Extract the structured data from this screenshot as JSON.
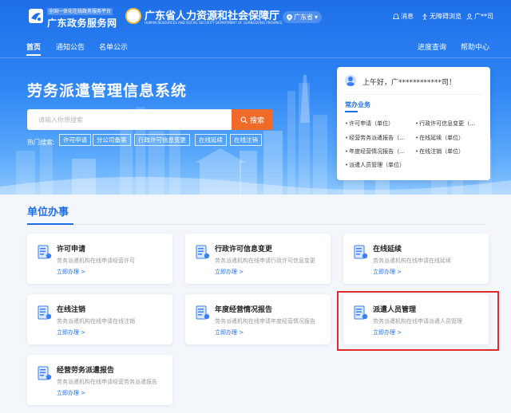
{
  "header": {
    "logo_small": "全国一体化在线政务服务平台",
    "logo_main": "广东政务服务网",
    "dept_name": "广东省人力资源和社会保障厅",
    "dept_en": "HUMAN RESOURCES AND SOCIAL SECURITY DEPARTMENT OF GUANGDONG PROVINCE",
    "region": "广东省",
    "messages": "消息",
    "accessibility": "无障碍浏览",
    "user": "广**司"
  },
  "nav": {
    "items": [
      "首页",
      "通知公告",
      "名单公示"
    ],
    "right_items": [
      "进度查询",
      "帮助中心"
    ]
  },
  "hero": {
    "title": "劳务派遣管理信息系统",
    "search_placeholder": "请输入你想搜索",
    "search_button": "搜索",
    "hot_label": "热门搜索:",
    "hot_tags": [
      "许可申请",
      "分公司备案",
      "行政许可信息变更",
      "在线延续",
      "在线注销"
    ]
  },
  "panel": {
    "greeting": "上午好，广************司！",
    "subtitle": "常办业务",
    "links": [
      "许可申请（单位）",
      "行政许可信息变更（...",
      "经营劳务派遣报告（...",
      "在线延续（单位）",
      "年度经营情况报告（...",
      "在线注销（单位）",
      "派遣人员管理（单位）"
    ]
  },
  "section": {
    "title": "单位办事"
  },
  "cards": [
    {
      "title": "许可申请",
      "desc": "劳务派遣机构在线申请经营许可",
      "link": "立即办理 >"
    },
    {
      "title": "行政许可信息变更",
      "desc": "劳务派遣机构在线申请行政许可信息变更",
      "link": "立即办理 >"
    },
    {
      "title": "在线延续",
      "desc": "劳务派遣机构在线申请在线延续",
      "link": "立即办理 >"
    },
    {
      "title": "在线注销",
      "desc": "劳务派遣机构在线申请在线注销",
      "link": "立即办理 >"
    },
    {
      "title": "年度经营情况报告",
      "desc": "劳务派遣机构在线申请年度经营情况报告",
      "link": "立即办理 >"
    },
    {
      "title": "派遣人员管理",
      "desc": "劳务派遣机构在线申请派遣人员管理",
      "link": "立即办理 >"
    },
    {
      "title": "经营劳务派遣报告",
      "desc": "劳务派遣机构在线申请经营劳务派遣报告",
      "link": "立即办理 >"
    }
  ],
  "colors": {
    "primary": "#1e6fe8",
    "search_button": "#f06a2a",
    "highlight": "#e02b2b"
  }
}
